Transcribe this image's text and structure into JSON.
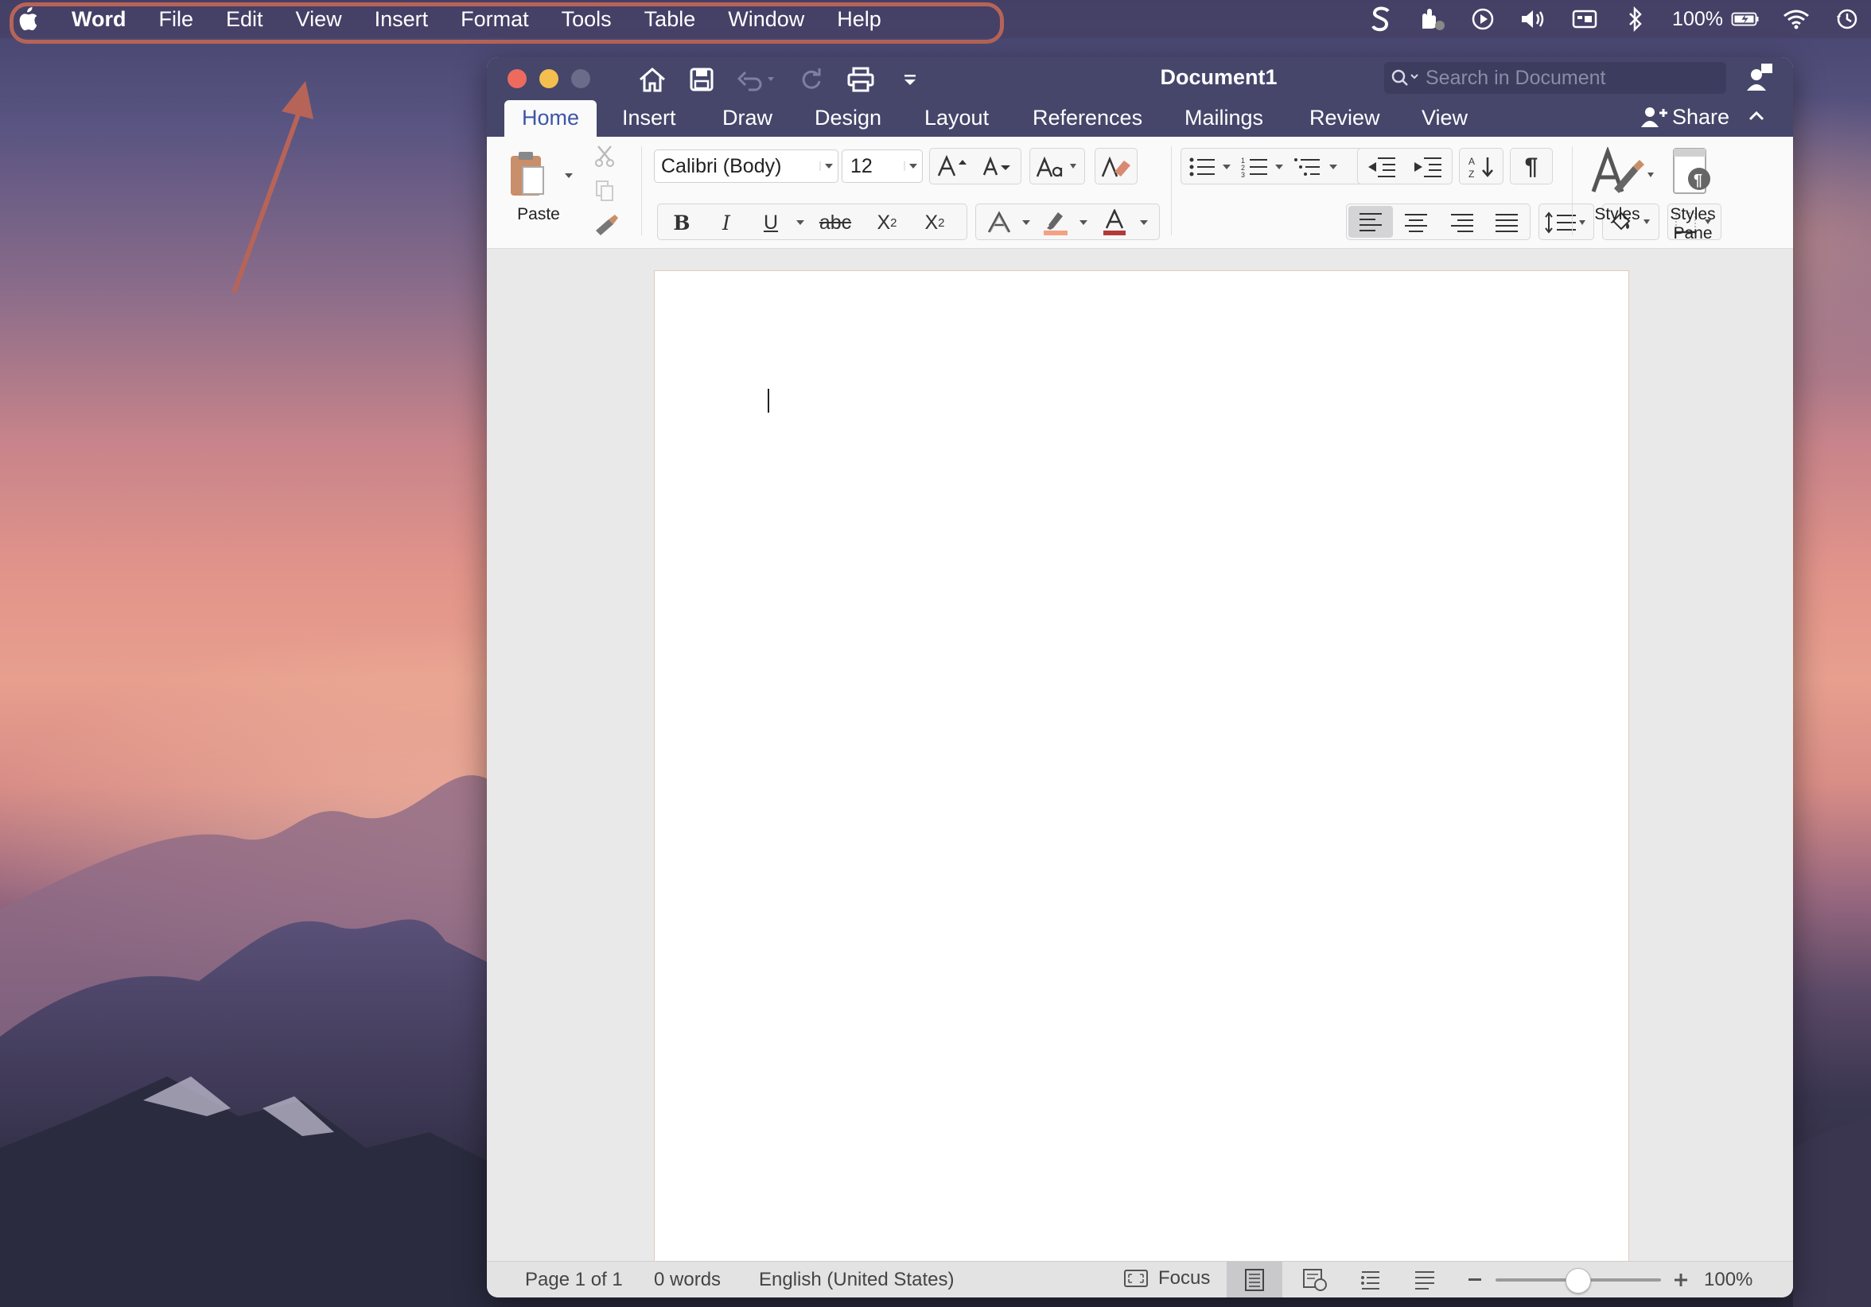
{
  "menubar": {
    "app_name": "Word",
    "items": [
      "File",
      "Edit",
      "View",
      "Insert",
      "Format",
      "Tools",
      "Table",
      "Window",
      "Help"
    ],
    "status": {
      "battery": "100%"
    },
    "highlight_color": "#b76458"
  },
  "window": {
    "title": "Document1",
    "search_placeholder": "Search in Document",
    "tabs": [
      "Home",
      "Insert",
      "Draw",
      "Design",
      "Layout",
      "References",
      "Mailings",
      "Review",
      "View"
    ],
    "active_tab": "Home",
    "share_label": "Share",
    "accent": "#45466a"
  },
  "ribbon": {
    "paste_label": "Paste",
    "font_name": "Calibri (Body)",
    "font_size": "12",
    "bold": "B",
    "italic": "I",
    "underline": "U",
    "strike": "abc",
    "subscript": "X",
    "subscript_mark": "2",
    "superscript": "X",
    "superscript_mark": "2",
    "styles_label": "Styles",
    "styles_pane_label_1": "Styles",
    "styles_pane_label_2": "Pane"
  },
  "statusbar": {
    "page": "Page 1 of 1",
    "words": "0 words",
    "language": "English (United States)",
    "focus": "Focus",
    "zoom": "100%"
  }
}
